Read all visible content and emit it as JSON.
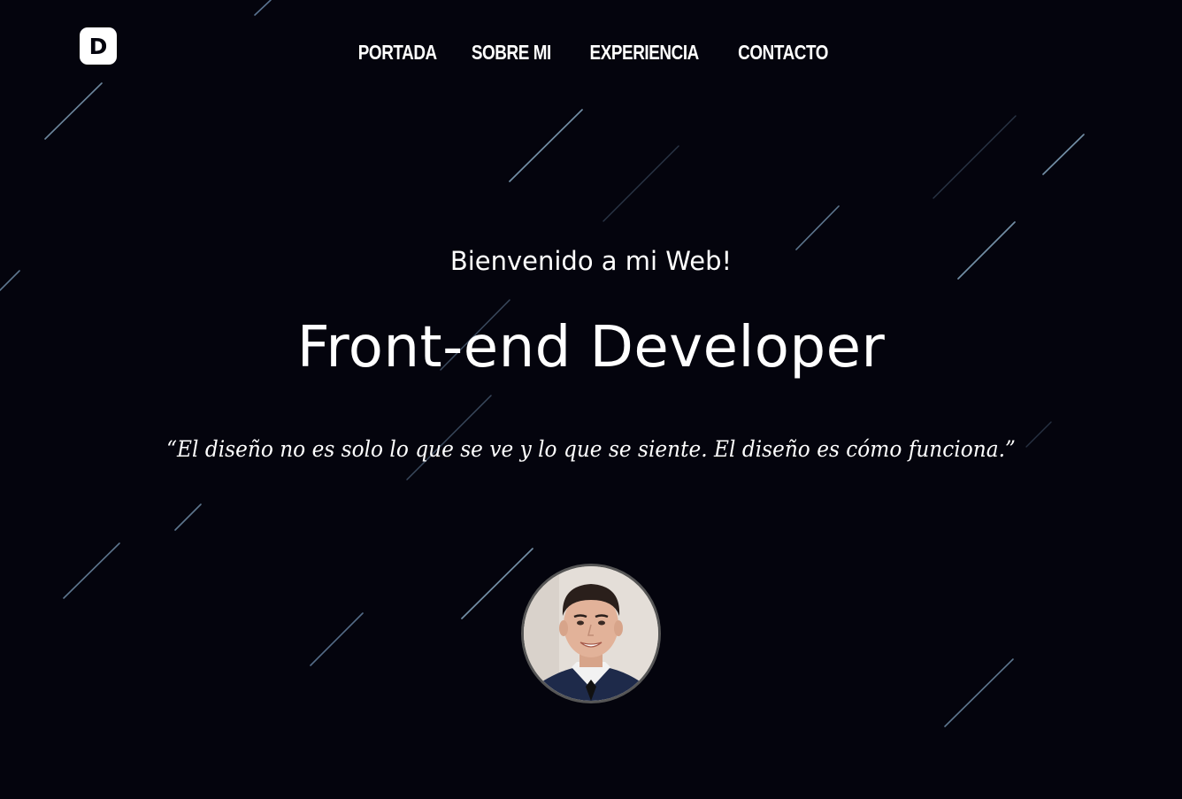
{
  "logo": {
    "letter": "D"
  },
  "nav": {
    "items": [
      {
        "label": "PORTADA"
      },
      {
        "label": "SOBRE MI"
      },
      {
        "label": "EXPERIENCIA"
      },
      {
        "label": "CONTACTO"
      }
    ]
  },
  "hero": {
    "welcome": "Bienvenido a mi Web!",
    "title": "Front-end Developer",
    "quote": "“El diseño no es solo lo que se ve y lo que se siente. El diseño es cómo funciona.”"
  },
  "colors": {
    "background": "#04040d",
    "text": "#ffffff",
    "streak": "#8fb2cc"
  }
}
